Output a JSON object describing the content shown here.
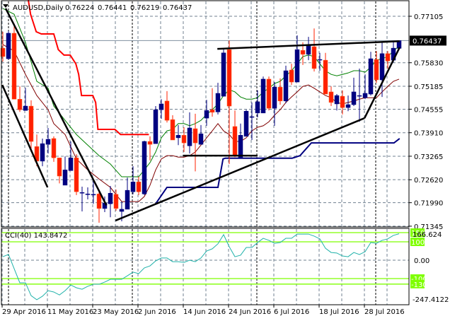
{
  "header": {
    "symbol": "AUDUSD,Daily",
    "open": "0.76224",
    "high": "0.76441",
    "low": "0.76219",
    "close": "0.76437"
  },
  "colors": {
    "bull": "#000080",
    "bear": "#ff2000",
    "ma_fast": "#008000",
    "ma_slow": "#800000",
    "stop_red": "#ff0000",
    "stop_blue": "#000080",
    "cci": "#20b2aa",
    "levels": "#7fff00",
    "grid": "#708090"
  },
  "chart_data": [
    {
      "type": "candlestick",
      "title": "AUDUSD,Daily",
      "price_axis_labels": [
        "0.77105",
        "0.76437",
        "0.75830",
        "0.75185",
        "0.74555",
        "0.73910",
        "0.73265",
        "0.72620",
        "0.71990",
        "0.71345"
      ],
      "current_price_label": "0.76437",
      "ylim": [
        0.71345,
        0.7734
      ],
      "date_labels": [
        "29 Apr 2016",
        "11 May 2016",
        "23 May 2016",
        "2 Jun 2016",
        "14 Jun 2016",
        "24 Jun 2016",
        "6 Jul 2016",
        "18 Jul 2016",
        "28 Jul 2016"
      ],
      "date_label_index": [
        0,
        8,
        16,
        24,
        32,
        40,
        48,
        56,
        64
      ],
      "ohlc": [
        [
          0.7623,
          0.7668,
          0.7586,
          0.76
        ],
        [
          0.7594,
          0.767,
          0.7592,
          0.7664
        ],
        [
          0.7664,
          0.7691,
          0.7483,
          0.7483
        ],
        [
          0.7483,
          0.7518,
          0.7448,
          0.7454
        ],
        [
          0.7452,
          0.7514,
          0.7452,
          0.7464
        ],
        [
          0.7464,
          0.748,
          0.7338,
          0.7367
        ],
        [
          0.7353,
          0.7386,
          0.7299,
          0.7313
        ],
        [
          0.7313,
          0.7375,
          0.7299,
          0.7361
        ],
        [
          0.7359,
          0.7404,
          0.7334,
          0.7373
        ],
        [
          0.7375,
          0.7381,
          0.7311,
          0.7322
        ],
        [
          0.7322,
          0.7322,
          0.7252,
          0.7272
        ],
        [
          0.7247,
          0.7326,
          0.7247,
          0.7289
        ],
        [
          0.7287,
          0.7367,
          0.7287,
          0.7322
        ],
        [
          0.7322,
          0.7332,
          0.722,
          0.7229
        ],
        [
          0.7227,
          0.7243,
          0.7175,
          0.7227
        ],
        [
          0.7223,
          0.7241,
          0.7208,
          0.7223
        ],
        [
          0.722,
          0.726,
          0.7196,
          0.7222
        ],
        [
          0.7223,
          0.7231,
          0.7144,
          0.7183
        ],
        [
          0.7183,
          0.7216,
          0.7173,
          0.7198
        ],
        [
          0.7196,
          0.7245,
          0.7159,
          0.7225
        ],
        [
          0.7222,
          0.7235,
          0.7177,
          0.7183
        ],
        [
          0.7175,
          0.7202,
          0.7148,
          0.7181
        ],
        [
          0.7181,
          0.7268,
          0.7181,
          0.7233
        ],
        [
          0.7229,
          0.7299,
          0.7222,
          0.7256
        ],
        [
          0.7256,
          0.727,
          0.722,
          0.7229
        ],
        [
          0.7223,
          0.7369,
          0.722,
          0.7367
        ],
        [
          0.7367,
          0.7381,
          0.7315,
          0.7359
        ],
        [
          0.7361,
          0.7464,
          0.7361,
          0.7454
        ],
        [
          0.7454,
          0.7483,
          0.7429,
          0.747
        ],
        [
          0.7478,
          0.7505,
          0.7419,
          0.7425
        ],
        [
          0.7427,
          0.7439,
          0.7371,
          0.7371
        ],
        [
          0.7377,
          0.7412,
          0.7357,
          0.7384
        ],
        [
          0.7384,
          0.7406,
          0.7338,
          0.7363
        ],
        [
          0.7355,
          0.7447,
          0.7334,
          0.7404
        ],
        [
          0.7402,
          0.7443,
          0.7285,
          0.7363
        ],
        [
          0.7359,
          0.7412,
          0.7359,
          0.7388
        ],
        [
          0.7431,
          0.7481,
          0.741,
          0.7452
        ],
        [
          0.7454,
          0.7513,
          0.7435,
          0.7447
        ],
        [
          0.7448,
          0.7528,
          0.7441,
          0.7499
        ],
        [
          0.7491,
          0.7619,
          0.7491,
          0.761
        ],
        [
          0.7619,
          0.7644,
          0.7305,
          0.7464
        ],
        [
          0.7408,
          0.7452,
          0.7324,
          0.7326
        ],
        [
          0.7322,
          0.7416,
          0.7322,
          0.7384
        ],
        [
          0.7381,
          0.7454,
          0.7381,
          0.745
        ],
        [
          0.7435,
          0.7474,
          0.7371,
          0.7435
        ],
        [
          0.7445,
          0.7507,
          0.7433,
          0.7476
        ],
        [
          0.7445,
          0.7545,
          0.7445,
          0.7538
        ],
        [
          0.7538,
          0.7545,
          0.7452,
          0.7458
        ],
        [
          0.7458,
          0.753,
          0.741,
          0.7516
        ],
        [
          0.7516,
          0.754,
          0.7468,
          0.7478
        ],
        [
          0.7478,
          0.7575,
          0.7472,
          0.7561
        ],
        [
          0.7563,
          0.758,
          0.7522,
          0.753
        ],
        [
          0.753,
          0.7658,
          0.753,
          0.7619
        ],
        [
          0.7617,
          0.7639,
          0.7577,
          0.7606
        ],
        [
          0.7606,
          0.7654,
          0.759,
          0.7631
        ],
        [
          0.7627,
          0.7677,
          0.7559,
          0.7567
        ],
        [
          0.7592,
          0.761,
          0.7561,
          0.7592
        ],
        [
          0.759,
          0.761,
          0.7497,
          0.7497
        ],
        [
          0.7503,
          0.7518,
          0.7464,
          0.7474
        ],
        [
          0.747,
          0.7497,
          0.7452,
          0.7493
        ],
        [
          0.7491,
          0.7507,
          0.7441,
          0.746
        ],
        [
          0.746,
          0.7493,
          0.745,
          0.7468
        ],
        [
          0.7468,
          0.7542,
          0.7464,
          0.7503
        ],
        [
          0.7493,
          0.7567,
          0.7421,
          0.7493
        ],
        [
          0.7487,
          0.7551,
          0.7483,
          0.7499
        ],
        [
          0.7497,
          0.7613,
          0.7493,
          0.7594
        ],
        [
          0.7592,
          0.7615,
          0.7528,
          0.7536
        ],
        [
          0.7536,
          0.7639,
          0.7489,
          0.7608
        ],
        [
          0.7608,
          0.7615,
          0.7567,
          0.7588
        ],
        [
          0.759,
          0.7642,
          0.7584,
          0.7623
        ],
        [
          0.76224,
          0.76441,
          0.76219,
          0.76437
        ]
      ],
      "ma_fast": [
        [
          0,
          0.7732
        ],
        [
          2,
          0.7716
        ],
        [
          4,
          0.7639
        ],
        [
          6,
          0.7532
        ],
        [
          8,
          0.7513
        ],
        [
          9,
          0.7464
        ],
        [
          11,
          0.7425
        ],
        [
          13,
          0.7386
        ],
        [
          15,
          0.7357
        ],
        [
          17,
          0.7328
        ],
        [
          19,
          0.7305
        ],
        [
          21,
          0.727
        ],
        [
          23,
          0.727
        ],
        [
          24,
          0.727
        ],
        [
          25,
          0.7289
        ],
        [
          26,
          0.7309
        ],
        [
          27,
          0.7338
        ],
        [
          28,
          0.7377
        ],
        [
          29,
          0.7396
        ],
        [
          30,
          0.74
        ],
        [
          31,
          0.7416
        ],
        [
          32,
          0.7416
        ],
        [
          33,
          0.741
        ],
        [
          34,
          0.7416
        ],
        [
          35,
          0.7425
        ],
        [
          36,
          0.7441
        ],
        [
          37,
          0.7454
        ],
        [
          38,
          0.747
        ],
        [
          39,
          0.7493
        ],
        [
          40,
          0.7509
        ],
        [
          41,
          0.7503
        ],
        [
          42,
          0.7489
        ],
        [
          43,
          0.7483
        ],
        [
          44,
          0.7483
        ],
        [
          45,
          0.7487
        ],
        [
          46,
          0.7503
        ],
        [
          47,
          0.7513
        ],
        [
          48,
          0.7526
        ],
        [
          49,
          0.7532
        ],
        [
          50,
          0.7547
        ],
        [
          51,
          0.7561
        ],
        [
          52,
          0.758
        ],
        [
          53,
          0.76
        ],
        [
          54,
          0.7604
        ],
        [
          55,
          0.76
        ],
        [
          56,
          0.758
        ],
        [
          57,
          0.7561
        ],
        [
          58,
          0.7551
        ],
        [
          59,
          0.7547
        ],
        [
          60,
          0.7551
        ],
        [
          61,
          0.7555
        ],
        [
          62,
          0.7561
        ],
        [
          63,
          0.7561
        ],
        [
          64,
          0.7557
        ],
        [
          65,
          0.7571
        ],
        [
          66,
          0.759
        ],
        [
          67,
          0.7594
        ],
        [
          68,
          0.76
        ],
        [
          69,
          0.7615
        ],
        [
          70,
          0.7629
        ]
      ],
      "ma_slow": [
        [
          0,
          0.7633
        ],
        [
          2,
          0.7615
        ],
        [
          4,
          0.7551
        ],
        [
          6,
          0.7493
        ],
        [
          8,
          0.7454
        ],
        [
          9,
          0.7416
        ],
        [
          11,
          0.7386
        ],
        [
          13,
          0.7319
        ],
        [
          15,
          0.7289
        ],
        [
          17,
          0.7264
        ],
        [
          19,
          0.7241
        ],
        [
          21,
          0.7202
        ],
        [
          23,
          0.7202
        ],
        [
          24,
          0.7202
        ],
        [
          25,
          0.7216
        ],
        [
          26,
          0.7247
        ],
        [
          27,
          0.7289
        ],
        [
          28,
          0.7319
        ],
        [
          29,
          0.7328
        ],
        [
          30,
          0.7328
        ],
        [
          31,
          0.7324
        ],
        [
          32,
          0.7324
        ],
        [
          33,
          0.7328
        ],
        [
          34,
          0.7338
        ],
        [
          35,
          0.7357
        ],
        [
          36,
          0.7377
        ],
        [
          37,
          0.7396
        ],
        [
          38,
          0.7416
        ],
        [
          39,
          0.7396
        ],
        [
          40,
          0.7386
        ],
        [
          41,
          0.7367
        ],
        [
          42,
          0.7367
        ],
        [
          43,
          0.7377
        ],
        [
          44,
          0.7396
        ],
        [
          45,
          0.7406
        ],
        [
          46,
          0.741
        ],
        [
          47,
          0.7421
        ],
        [
          48,
          0.7439
        ],
        [
          49,
          0.7454
        ],
        [
          50,
          0.7474
        ],
        [
          51,
          0.7489
        ],
        [
          52,
          0.7503
        ],
        [
          53,
          0.7518
        ],
        [
          54,
          0.7522
        ],
        [
          55,
          0.7513
        ],
        [
          56,
          0.7503
        ],
        [
          57,
          0.7493
        ],
        [
          58,
          0.7487
        ],
        [
          59,
          0.7474
        ],
        [
          60,
          0.747
        ],
        [
          61,
          0.7474
        ],
        [
          62,
          0.7478
        ],
        [
          63,
          0.7483
        ],
        [
          64,
          0.7487
        ],
        [
          65,
          0.7487
        ],
        [
          66,
          0.7487
        ],
        [
          67,
          0.7503
        ],
        [
          68,
          0.7518
        ],
        [
          69,
          0.7532
        ],
        [
          70,
          0.7538
        ]
      ],
      "stop_red": [
        [
          4.5,
          0.7755
        ],
        [
          4.9,
          0.7716
        ],
        [
          5.9,
          0.7668
        ],
        [
          6.8,
          0.7662
        ],
        [
          9,
          0.7662
        ],
        [
          9.8,
          0.7619
        ],
        [
          10.8,
          0.7604
        ],
        [
          11.9,
          0.7604
        ],
        [
          12.9,
          0.758
        ],
        [
          13.4,
          0.7551
        ],
        [
          13.9,
          0.7493
        ],
        [
          15.9,
          0.7493
        ],
        [
          16.4,
          0.7474
        ],
        [
          16.8,
          0.74
        ],
        [
          19.8,
          0.74
        ],
        [
          20.8,
          0.7386
        ],
        [
          25.8,
          0.7386
        ]
      ],
      "stop_blue": [
        [
          27,
          0.7196
        ],
        [
          28.9,
          0.7239
        ],
        [
          29,
          0.7241
        ],
        [
          38,
          0.7241
        ],
        [
          38.9,
          0.7319
        ],
        [
          39.3,
          0.7321
        ],
        [
          51.1,
          0.7321
        ],
        [
          51.5,
          0.7323
        ],
        [
          52.5,
          0.7328
        ],
        [
          53.3,
          0.7342
        ],
        [
          54.5,
          0.7363
        ],
        [
          69.1,
          0.7363
        ],
        [
          70.1,
          0.7375
        ]
      ],
      "trendlines": [
        {
          "name": "downtrend-upper",
          "from": [
            0.5,
            0.7732
          ],
          "to": [
            18.3,
            0.7192
          ]
        },
        {
          "name": "downtrend-lower",
          "from": [
            -0.1,
            0.7522
          ],
          "to": [
            7.9,
            0.7241
          ]
        },
        {
          "name": "uptrend-support",
          "from": [
            19.9,
            0.715
          ],
          "to": [
            63.9,
            0.7431
          ]
        },
        {
          "name": "uptrend-steep",
          "from": [
            63.9,
            0.7431
          ],
          "to": [
            70.1,
            0.7625
          ]
        },
        {
          "name": "resistance",
          "from": [
            37.9,
            0.7621
          ],
          "to": [
            70.1,
            0.7642
          ]
        },
        {
          "name": "horizontal-support",
          "from": [
            31.8,
            0.7328
          ],
          "to": [
            45,
            0.7328
          ]
        }
      ]
    },
    {
      "type": "line",
      "title": "CCI(40) 143.8472",
      "label": "CCI(40)",
      "last_value": "143.8472",
      "ylim": [
        -247.4122,
        166.624
      ],
      "axis_labels": {
        "max": "166.624",
        "zero": "0.00",
        "min": "-247.4122"
      },
      "levels": [
        {
          "value": 150,
          "label": "150"
        },
        {
          "value": 100,
          "label": "100"
        },
        {
          "value": -100,
          "label": "-100"
        },
        {
          "value": -130,
          "label": "-130"
        }
      ],
      "values": [
        19,
        31,
        -46,
        -123,
        -123,
        -193,
        -215,
        -196,
        -166,
        -173,
        -189,
        -166,
        -135,
        -150,
        -158,
        -142,
        -131,
        -131,
        -119,
        -104,
        -104,
        -104,
        -85,
        -65,
        -73,
        -42,
        -31,
        -4,
        12,
        12,
        -8,
        -8,
        -12,
        0,
        -8,
        12,
        50,
        62,
        89,
        139,
        73,
        19,
        27,
        69,
        69,
        96,
        119,
        108,
        92,
        96,
        119,
        119,
        142,
        142,
        142,
        131,
        116,
        65,
        42,
        39,
        23,
        19,
        42,
        31,
        46,
        96,
        92,
        108,
        116,
        135,
        143.85
      ]
    }
  ]
}
